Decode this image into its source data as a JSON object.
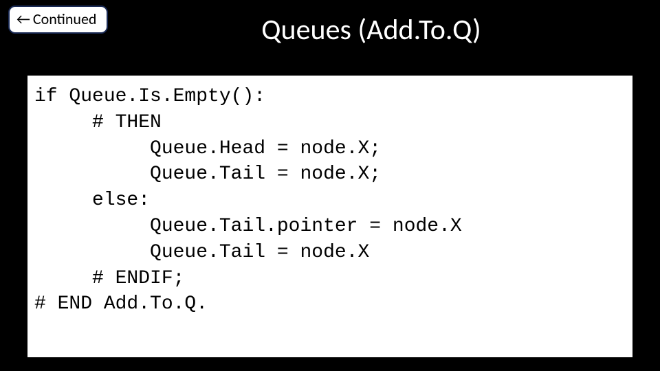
{
  "header": {
    "continued_label": "Continued",
    "title": "Queues (Add.To.Q)"
  },
  "code": {
    "lines": [
      "if Queue.Is.Empty():",
      "     # THEN",
      "          Queue.Head = node.X;",
      "          Queue.Tail = node.X;",
      "     else:",
      "          Queue.Tail.pointer = node.X",
      "          Queue.Tail = node.X",
      "     # ENDIF;",
      "# END Add.To.Q."
    ]
  }
}
